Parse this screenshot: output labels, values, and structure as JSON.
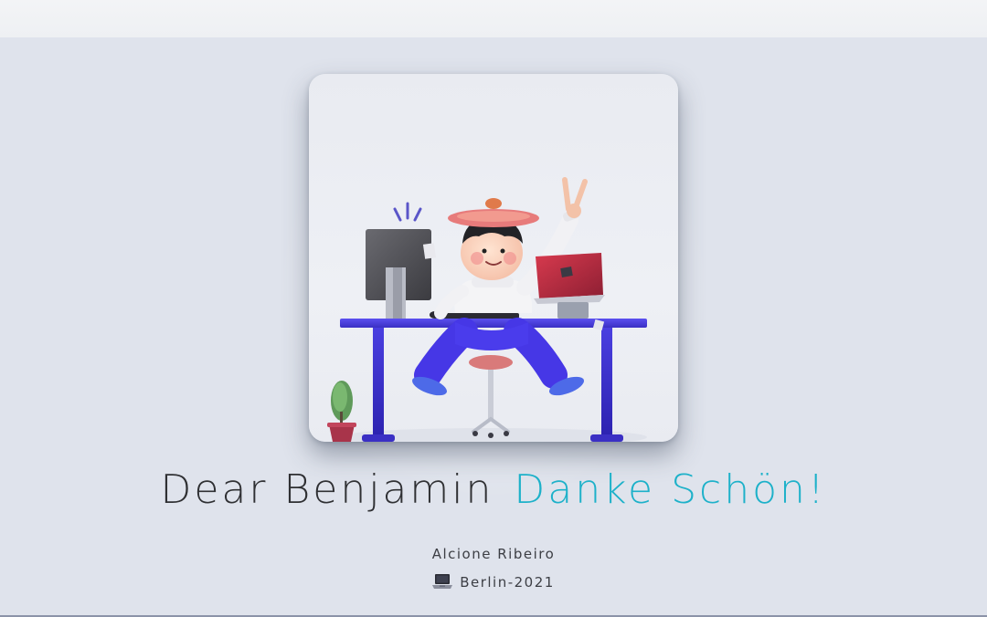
{
  "header": {
    "greeting": "Dear Benjamin",
    "thanks": "Danke Schön!"
  },
  "credits": {
    "author": "Alcione Ribeiro",
    "location": "Berlin-2021",
    "location_icon": "laptop-icon"
  },
  "colors": {
    "background": "#dfe3ec",
    "accent": "#1db1c9",
    "text": "#2f3033",
    "desk": "#4a3fd6"
  },
  "illustration": {
    "icon": "person-at-desk-illustration"
  }
}
